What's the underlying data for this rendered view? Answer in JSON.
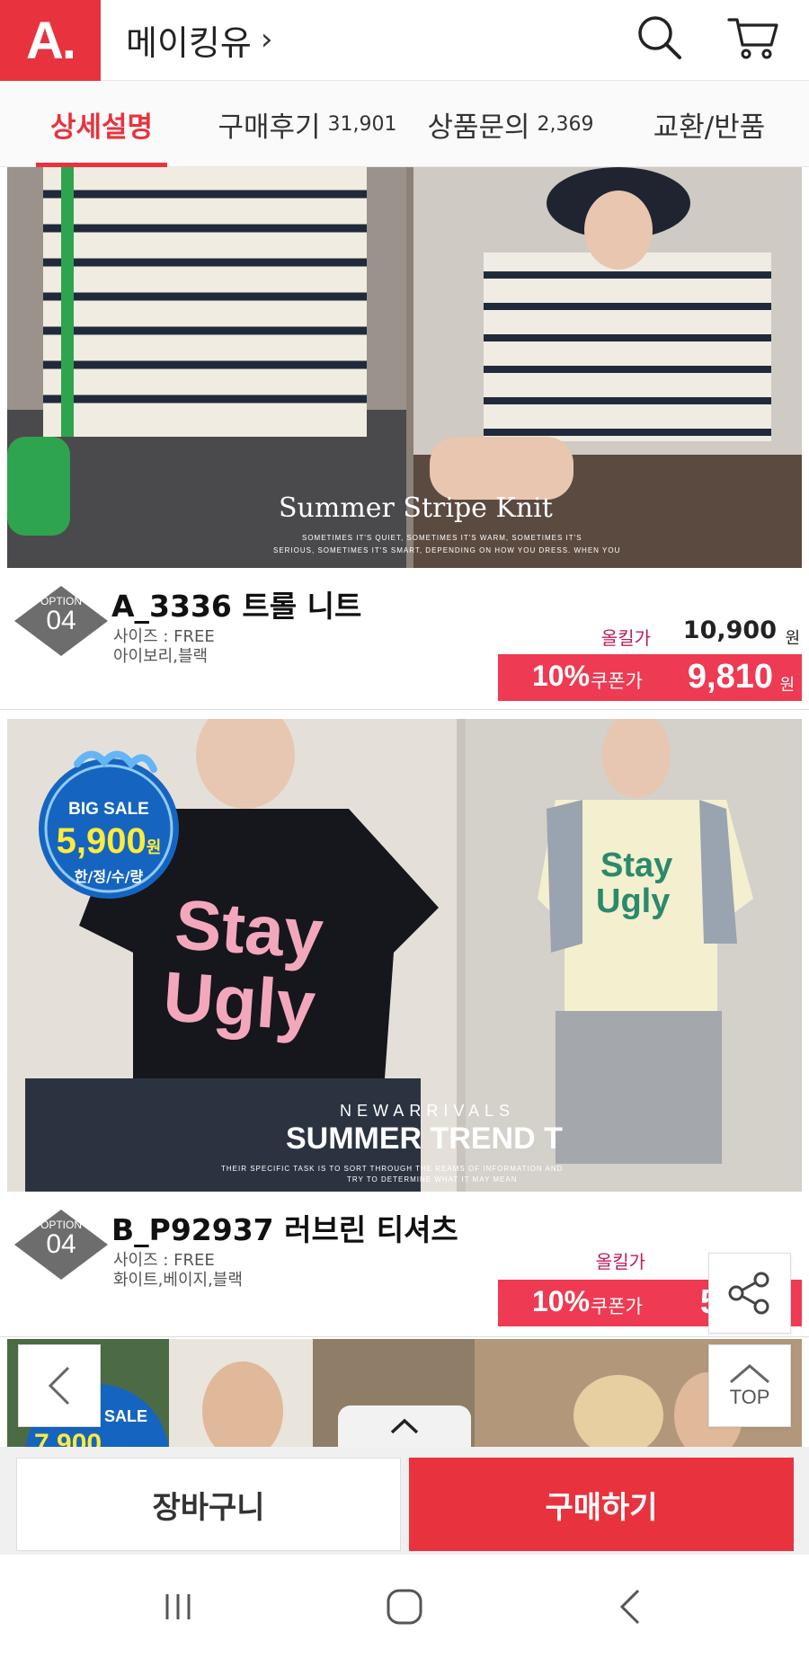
{
  "header": {
    "logo_text": "A.",
    "shop_name": "메이킹유",
    "chevron": "›",
    "icons": [
      "search-icon",
      "cart-icon"
    ]
  },
  "tabs": [
    {
      "label": "상세설명",
      "count": "",
      "active": true
    },
    {
      "label": "구매후기",
      "count": "31,901",
      "active": false
    },
    {
      "label": "상품문의",
      "count": "2,369",
      "active": false
    },
    {
      "label": "교환/반품",
      "count": "",
      "active": false
    }
  ],
  "products": [
    {
      "photo_title": "Summer Stripe Knit",
      "photo_caption_1": "SOMETIMES IT'S QUIET, SOMETIMES IT'S WARM, SOMETIMES IT'S",
      "photo_caption_2": "SERIOUS, SOMETIMES IT'S SMART, DEPENDING ON HOW YOU DRESS. WHEN YOU",
      "option_label": "OPTION",
      "option_num": "04",
      "name": "A_3336 트롤 니트",
      "size": "사이즈 : FREE",
      "colors": "아이보리,블랙",
      "orig_label": "올킬가",
      "orig_price": "10,900",
      "won": "원",
      "coupon_rate": "10%",
      "coupon_label": "쿠폰가",
      "coupon_price": "9,810"
    },
    {
      "sale_top": "BIG SALE",
      "sale_price": "5,900",
      "sale_won": "원",
      "sale_bottom": "한/정/수/량",
      "tee_text_1": "Stay",
      "tee_text_2": "Ugly",
      "new_arrivals": "NEWARRIVALS",
      "photo_title": "SUMMER TREND T",
      "photo_caption_1": "THEIR SPECIFIC TASK IS TO SORT THROUGH THE REAMS OF INFORMATION AND",
      "photo_caption_2": "TRY TO DETERMINE WHAT IT MAY MEAN",
      "option_label": "OPTION",
      "option_num": "04",
      "name": "B_P92937 러브린 티셔츠",
      "size": "사이즈 : FREE",
      "colors": "화이트,베이지,블랙",
      "orig_label": "올킬가",
      "coupon_rate": "10%",
      "coupon_label": "쿠폰가",
      "coupon_price_partial": "5"
    },
    {
      "sale_text": "SALE",
      "sale_price_partial": "7,900"
    }
  ],
  "floating": {
    "top_label": "TOP",
    "icons": [
      "share-icon",
      "chevron-left-icon",
      "chevron-up-icon"
    ]
  },
  "bottom_bar": {
    "cart_label": "장바구니",
    "buy_label": "구매하기"
  },
  "colors": {
    "brand_red": "#e8333e",
    "coupon_pink": "#ee3a52",
    "sale_blue": "#1565c0"
  }
}
